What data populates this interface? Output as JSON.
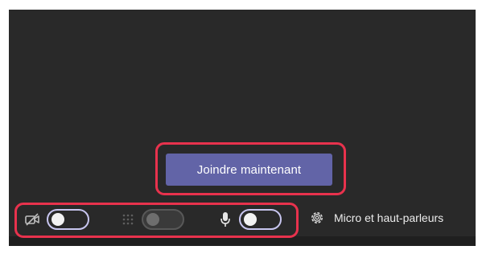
{
  "join": {
    "label": "Joindre maintenant"
  },
  "controls": {
    "camera": {
      "icon": "camera-off-icon",
      "state": "off"
    },
    "background": {
      "icon": "background-effects-icon",
      "state": "disabled"
    },
    "microphone": {
      "icon": "microphone-icon",
      "state": "off"
    }
  },
  "audio_settings": {
    "icon": "gear-icon",
    "label": "Micro et haut-parleurs"
  },
  "colors": {
    "panel_background": "#292929",
    "join_button": "#6264a7",
    "highlight": "#e8324d",
    "toggle_border": "#c8c6f0"
  }
}
